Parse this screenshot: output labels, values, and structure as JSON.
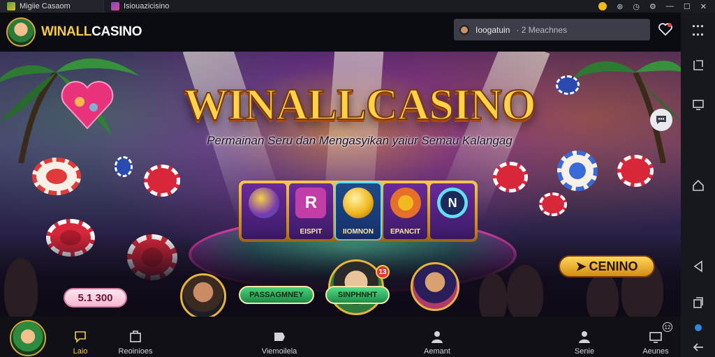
{
  "window": {
    "tabs": [
      {
        "label": "Migiie Casaom",
        "icon": "app-icon"
      },
      {
        "label": "Isiouazicisino",
        "icon": "app-icon"
      }
    ],
    "controls": [
      "coin-icon",
      "gamepad-icon",
      "clock-icon",
      "settings-icon",
      "minimize-icon",
      "maximize-icon",
      "close-icon"
    ]
  },
  "header": {
    "brand_prefix": "WINALL",
    "brand_suffix": "CASINO",
    "login": {
      "name": "Ioogatuin",
      "extra": "· 2 Meachnes"
    }
  },
  "banner": {
    "title": "WINALLCASINO",
    "subtitle": "Permainan Seru dan Mengasyikan yaiur Semau Kalangag",
    "reels": [
      {
        "label": "",
        "icon": "gem-ball-icon",
        "color": "#7a3ab0"
      },
      {
        "label": "EISPIT",
        "icon": "letter-r-icon",
        "color": "#c23ea6"
      },
      {
        "label": "IIOMNON",
        "icon": "gold-coin-icon",
        "color": "#f1b820"
      },
      {
        "label": "EPANCIT",
        "icon": "ring-coin-icon",
        "color": "#e6702a"
      },
      {
        "label": "",
        "icon": "letter-n-icon",
        "color": "#2a6ab5"
      }
    ],
    "money_badge": "5.1 300",
    "pass_label": "PASSAGMNEY",
    "sinph_label": "SINPHNHT",
    "casino_button": "CENINO",
    "avatar_badge": "13"
  },
  "bottom_nav": {
    "items": [
      {
        "label": "Laio",
        "icon": "chat-icon",
        "active": true
      },
      {
        "label": "Reoinioes",
        "icon": "bookmarks-icon",
        "active": false
      },
      {
        "label": "Viemoilela",
        "icon": "tag-icon",
        "active": false
      },
      {
        "label": "Aemant",
        "icon": "person-icon",
        "active": false
      },
      {
        "label": "Senie",
        "icon": "person-icon",
        "active": false
      },
      {
        "label": "Aeunes",
        "icon": "monitor-icon",
        "active": false
      }
    ],
    "badge": "12"
  },
  "sidebar": {
    "buttons": [
      "grid-icon",
      "crop-icon",
      "monitor-icon",
      "home-icon",
      "back-triangle-icon",
      "copy-icon",
      "location-icon",
      "arrow-left-icon"
    ]
  }
}
